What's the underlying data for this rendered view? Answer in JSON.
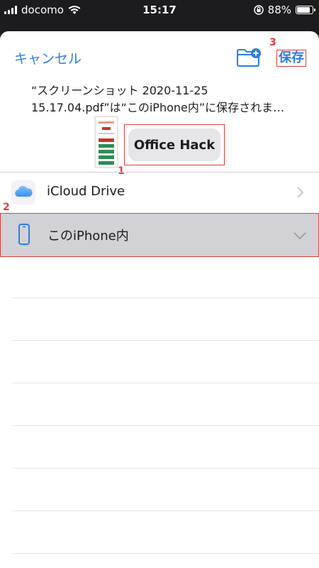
{
  "status_bar": {
    "carrier": "docomo",
    "time": "15:17",
    "battery_percent": "88%",
    "battery_level": 0.88
  },
  "sheet": {
    "cancel_label": "キャンセル",
    "save_label": "保存",
    "filename_line1": "“スクリーンショット 2020-11-25",
    "filename_line2": "15.17.04.pdf”は“このiPhone内”に保存されま…",
    "tag_label": "Office Hack"
  },
  "locations": [
    {
      "label": "iCloud Drive",
      "icon": "cloud-icon",
      "state": "collapsed"
    },
    {
      "label": "このiPhone内",
      "icon": "phone-icon",
      "state": "expanded"
    }
  ],
  "markers": {
    "tag": "1",
    "location": "2",
    "save": "3"
  },
  "colors": {
    "accent": "#2f7de1",
    "highlight": "#e23c3c",
    "selected_row": "#d1d1d6"
  }
}
